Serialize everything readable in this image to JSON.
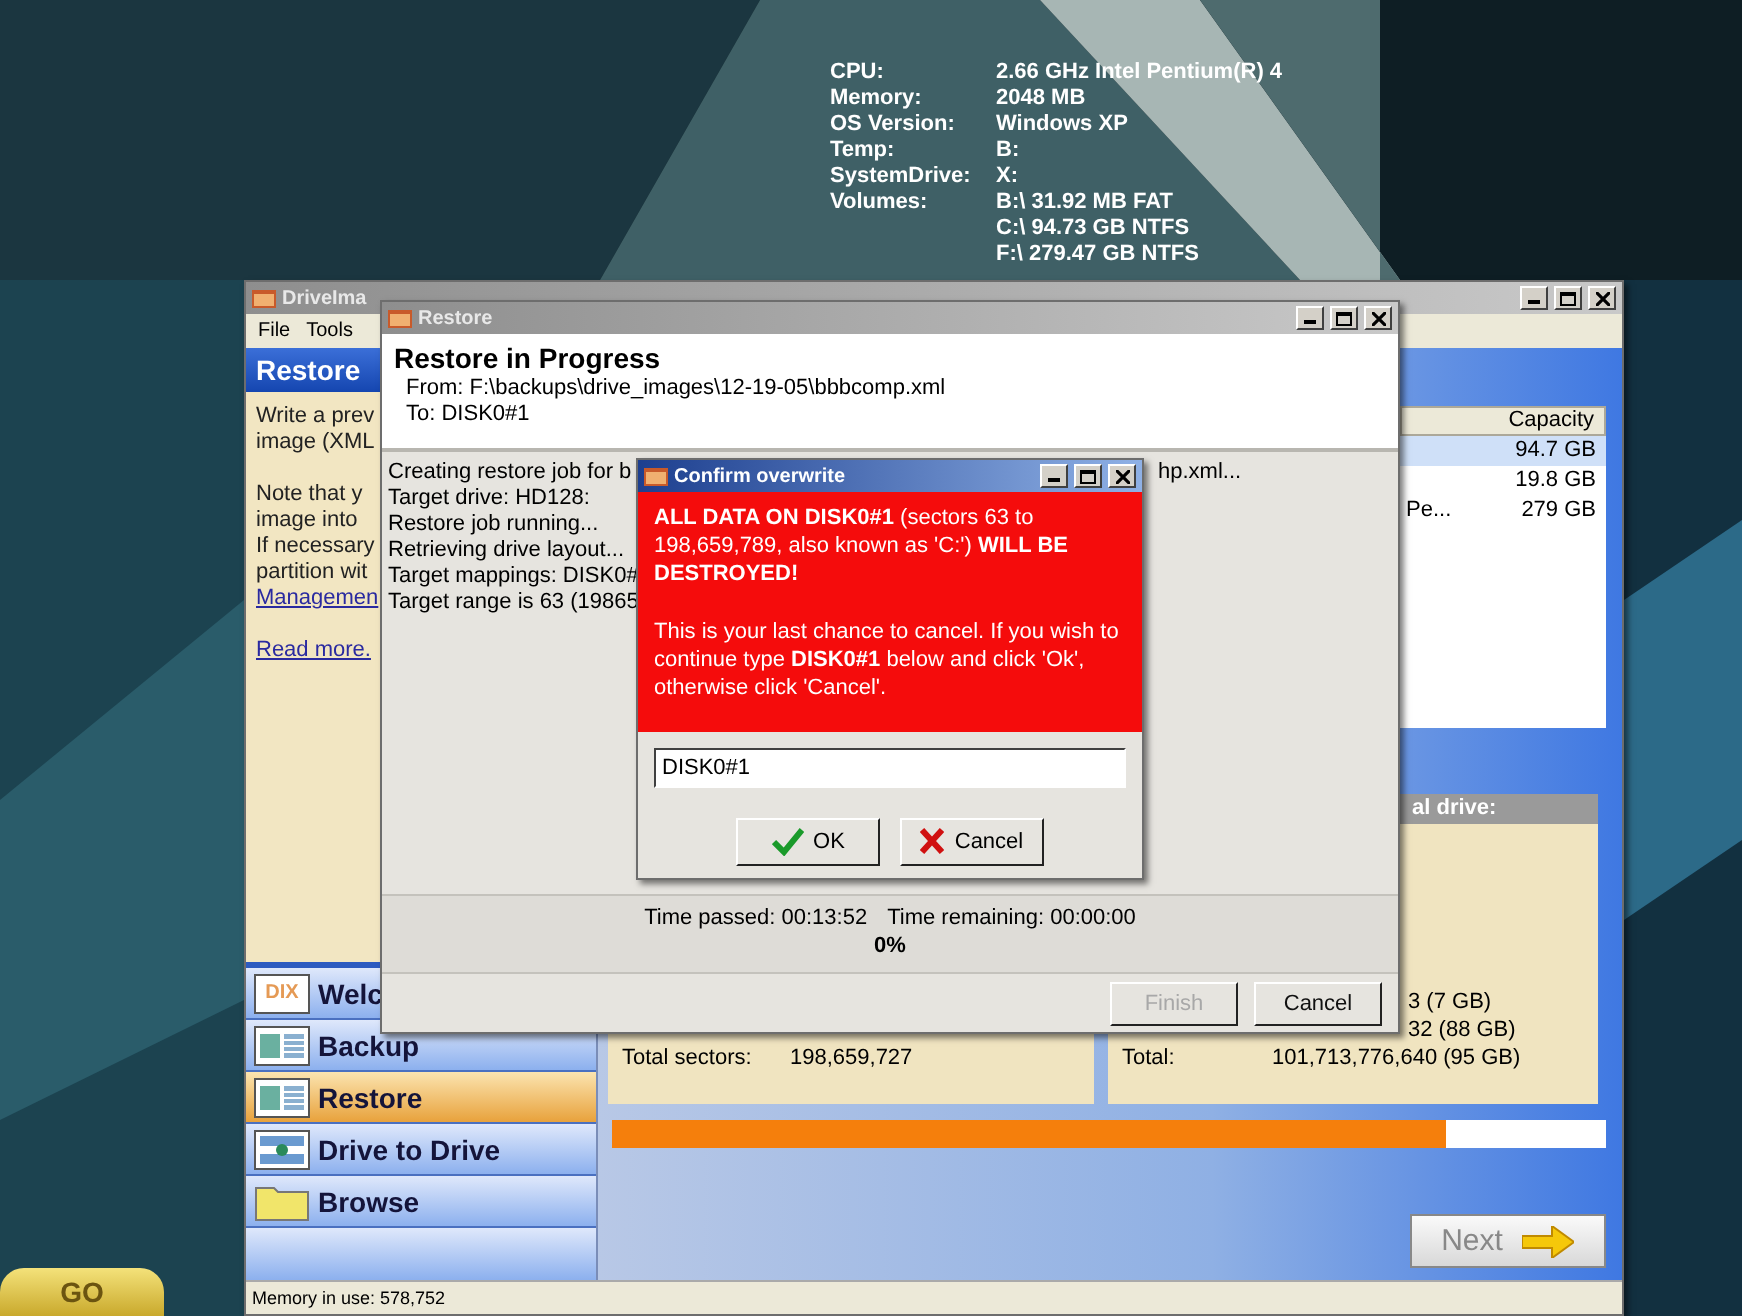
{
  "desktop": {
    "system_info": [
      {
        "label": "CPU:",
        "values": [
          "2.66 GHz Intel Pentium(R) 4"
        ]
      },
      {
        "label": "Memory:",
        "values": [
          "2048 MB"
        ]
      },
      {
        "label": "OS Version:",
        "values": [
          "Windows XP"
        ]
      },
      {
        "label": "Temp:",
        "values": [
          "B:"
        ]
      },
      {
        "label": "SystemDrive:",
        "values": [
          "X:"
        ]
      },
      {
        "label": "Volumes:",
        "values": [
          "B:\\ 31.92 MB FAT",
          "C:\\ 94.73 GB NTFS",
          "F:\\ 279.47 GB NTFS"
        ]
      }
    ],
    "go_button": "GO"
  },
  "main_window": {
    "title": "DriveIma",
    "menu": [
      "File",
      "Tools"
    ],
    "panel_title": "Restore",
    "panel_text": [
      [
        {
          "text": "Write a prev",
          "link": false
        },
        {
          "text": "image (XML",
          "link": false
        }
      ],
      [
        {
          "text": "Note that y",
          "link": false
        },
        {
          "text": "image into",
          "link": false
        },
        {
          "text": "If necessary",
          "link": false
        },
        {
          "text": "partition wit",
          "link": false
        },
        {
          "text": "Managemen",
          "link": true
        }
      ],
      [
        {
          "text": "Read more.",
          "link": true
        }
      ]
    ],
    "sidebar": [
      {
        "label": "Welc",
        "kind": "dix",
        "badge": "DIX",
        "selected": false
      },
      {
        "label": "Backup",
        "kind": "backup",
        "selected": false
      },
      {
        "label": "Restore",
        "kind": "restore",
        "selected": true
      },
      {
        "label": "Drive to Drive",
        "kind": "drive",
        "selected": false
      },
      {
        "label": "Browse",
        "kind": "folder",
        "selected": false
      }
    ],
    "table": {
      "columns": [
        "Capacity"
      ],
      "rows": [
        {
          "capacity": "94.7 GB",
          "selected": true
        },
        {
          "capacity": "19.8 GB",
          "selected": false
        },
        {
          "fragment": "Pe...",
          "capacity": "279 GB",
          "selected": false
        }
      ]
    },
    "source_panel": {
      "total_label": "Total sectors:",
      "total_value": "198,659,727"
    },
    "target_panel": {
      "header": "al drive:",
      "rows": [
        "3 (7 GB)",
        "32 (88 GB)"
      ],
      "total_label": "Total:",
      "total_value": "101,713,776,640 (95 GB)"
    },
    "progress": {
      "level": 0.84
    },
    "next_button": "Next",
    "status_bar": "Memory in use: 578,752"
  },
  "restore_dialog": {
    "title": "Restore",
    "heading": "Restore in Progress",
    "from": "From: F:\\backups\\drive_images\\12-19-05\\bbbcomp.xml",
    "to": "To: DISK0#1",
    "log": [
      "Creating restore job for b",
      "Target drive: HD128:",
      "Restore job running...",
      "Retrieving drive layout...",
      "Target mappings: DISK0#",
      "Target range is 63 (19865"
    ],
    "log_tail": "hp.xml...",
    "time_passed": "Time passed: 00:13:52",
    "time_remaining": "Time remaining: 00:00:00",
    "percent": "0%",
    "buttons": [
      {
        "label": "Finish",
        "disabled": true
      },
      {
        "label": "Cancel",
        "disabled": false
      }
    ]
  },
  "confirm_dialog": {
    "title": "Confirm overwrite",
    "warning": "**ALL DATA ON DISK0#1** (sectors 63 to 198,659,789, also known as 'C:') **WILL BE DESTROYED!**",
    "message": "This is your last chance to cancel. If you wish to continue type **DISK0#1** below and click 'Ok', otherwise click 'Cancel'.",
    "input_value": "DISK0#1",
    "buttons": [
      {
        "label": "OK",
        "kind": "ok"
      },
      {
        "label": "Cancel",
        "kind": "cancel"
      }
    ]
  }
}
